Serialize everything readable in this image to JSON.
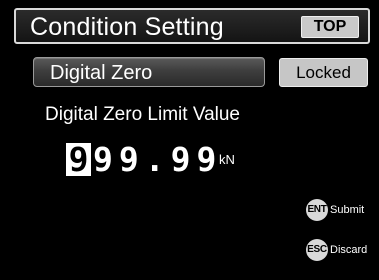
{
  "header": {
    "title": "Condition Setting",
    "top_button_label": "TOP"
  },
  "setting": {
    "item_label": "Digital Zero",
    "status": "Locked"
  },
  "value_editor": {
    "label": "Digital Zero Limit Value",
    "cursor_digit": "9",
    "value_rest": "99.99",
    "unit": "kN"
  },
  "softkeys": {
    "submit": {
      "key": "ENT",
      "label": "Submit"
    },
    "discard": {
      "key": "ESC",
      "label": "Discard"
    }
  },
  "colors": {
    "background": "#000000",
    "button_light": "#c9c9c9",
    "text": "#ffffff"
  }
}
